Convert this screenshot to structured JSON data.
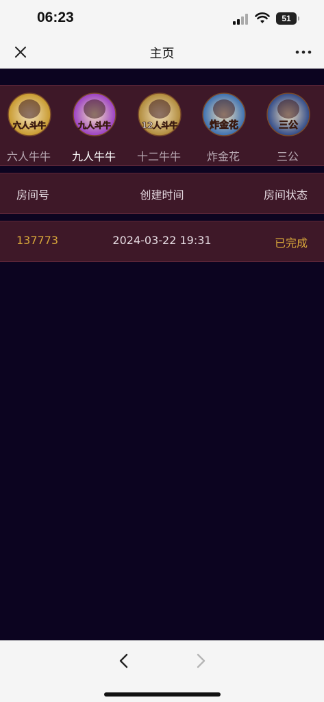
{
  "status_bar": {
    "time": "06:23",
    "battery": "51"
  },
  "nav": {
    "title": "主页"
  },
  "games": [
    {
      "label": "六人牛牛",
      "logo_text": "六人斗牛",
      "active": false,
      "color": "#c89a2e"
    },
    {
      "label": "九人牛牛",
      "logo_text": "九人斗牛",
      "active": true,
      "color": "#9b3fc4"
    },
    {
      "label": "十二牛牛",
      "logo_text": "12人斗牛",
      "active": false,
      "color": "#b08a3a"
    },
    {
      "label": "炸金花",
      "logo_text": "炸金花",
      "active": false,
      "color": "#3a6fb0"
    },
    {
      "label": "三公",
      "logo_text": "三公",
      "active": false,
      "color": "#2f4a8a"
    }
  ],
  "table": {
    "headers": {
      "room": "房间号",
      "time": "创建时间",
      "status": "房间状态"
    },
    "rows": [
      {
        "room": "137773",
        "time": "2024-03-22 19:31",
        "status": "已完成"
      }
    ]
  },
  "colors": {
    "background": "#0c0420",
    "panel": "#3e1828",
    "accent": "#d7a63a"
  }
}
